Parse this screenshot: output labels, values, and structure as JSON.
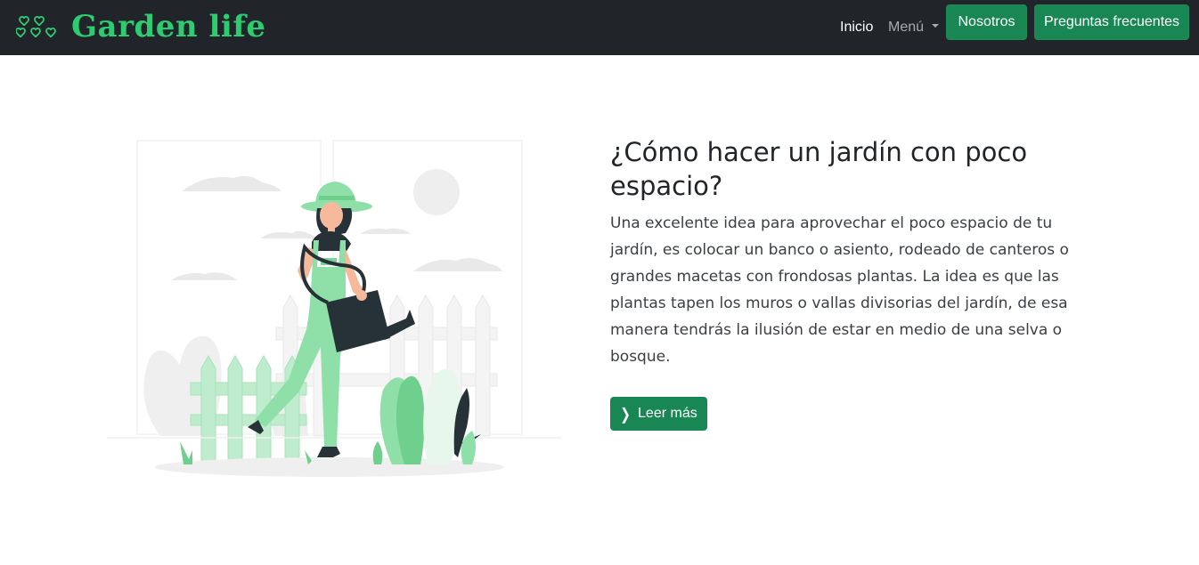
{
  "brand": {
    "name": "Garden life",
    "icon": "hearts-icon",
    "color": "#2ecc71"
  },
  "nav": {
    "home": "Inicio",
    "menu": "Menú",
    "about": "Nosotros",
    "faq": "Preguntas frecuentes"
  },
  "article": {
    "title": "¿Cómo hacer un jardín con poco espacio?",
    "body": "Una excelente idea para aprovechar el poco espacio de tu jardín, es colocar un banco o asiento, rodeado de canteros o grandes macetas con frondosas plantas. La idea es que las plantas tapen los muros o vallas divisorias del jardín, de esa manera tendrás la ilusión de estar en medio de una selva o bosque.",
    "button": "Leer más",
    "button_icon": "chevron-right-icon"
  },
  "illustration": {
    "icon": "gardener-watering-illustration"
  },
  "colors": {
    "navbar": "#212529",
    "accent": "#198754",
    "plant": "#8ee0a8"
  }
}
